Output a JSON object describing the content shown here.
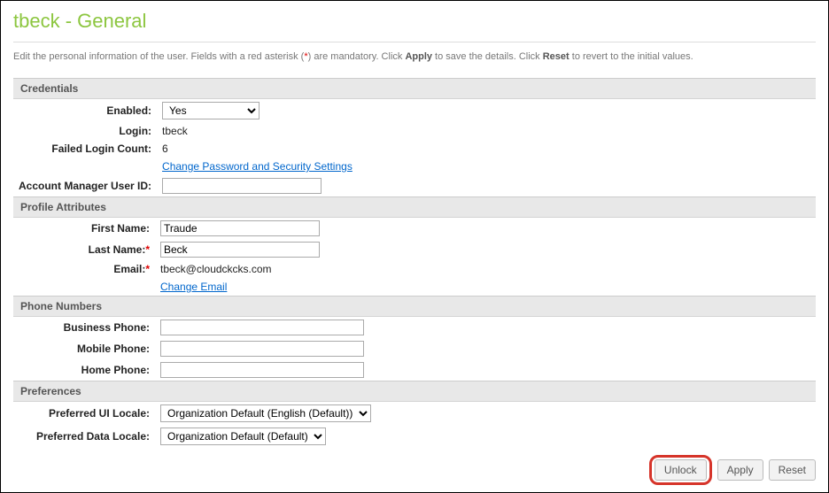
{
  "page_title": "tbeck - General",
  "instructions": {
    "prefix": "Edit the personal information of the user. Fields with a red asterisk (",
    "ast": "*",
    "mid1": ") are mandatory. Click ",
    "apply_bold": "Apply",
    "mid2": " to save the details. Click ",
    "reset_bold": "Reset",
    "suffix": " to revert to the initial values."
  },
  "sections": {
    "credentials": {
      "header": "Credentials",
      "fields": {
        "enabled": {
          "label": "Enabled:",
          "value": "Yes"
        },
        "login": {
          "label": "Login:",
          "value": "tbeck"
        },
        "failed_login_count": {
          "label": "Failed Login Count:",
          "value": "6"
        },
        "change_password_link": "Change Password and Security Settings",
        "account_manager_user_id": {
          "label": "Account Manager User ID:",
          "value": ""
        }
      }
    },
    "profile": {
      "header": "Profile Attributes",
      "fields": {
        "first_name": {
          "label": "First Name:",
          "value": "Traude"
        },
        "last_name": {
          "label": "Last Name:",
          "value": "Beck",
          "required": true
        },
        "email": {
          "label": "Email:",
          "value": "tbeck@cloudckcks.com",
          "required": true
        },
        "change_email_link": "Change Email"
      }
    },
    "phone": {
      "header": "Phone Numbers",
      "fields": {
        "business": {
          "label": "Business Phone:",
          "value": ""
        },
        "mobile": {
          "label": "Mobile Phone:",
          "value": ""
        },
        "home": {
          "label": "Home Phone:",
          "value": ""
        }
      }
    },
    "preferences": {
      "header": "Preferences",
      "fields": {
        "ui_locale": {
          "label": "Preferred UI Locale:",
          "value": "Organization Default (English (Default))"
        },
        "data_locale": {
          "label": "Preferred Data Locale:",
          "value": "Organization Default (Default)"
        }
      }
    }
  },
  "buttons": {
    "unlock": "Unlock",
    "apply": "Apply",
    "reset": "Reset"
  }
}
